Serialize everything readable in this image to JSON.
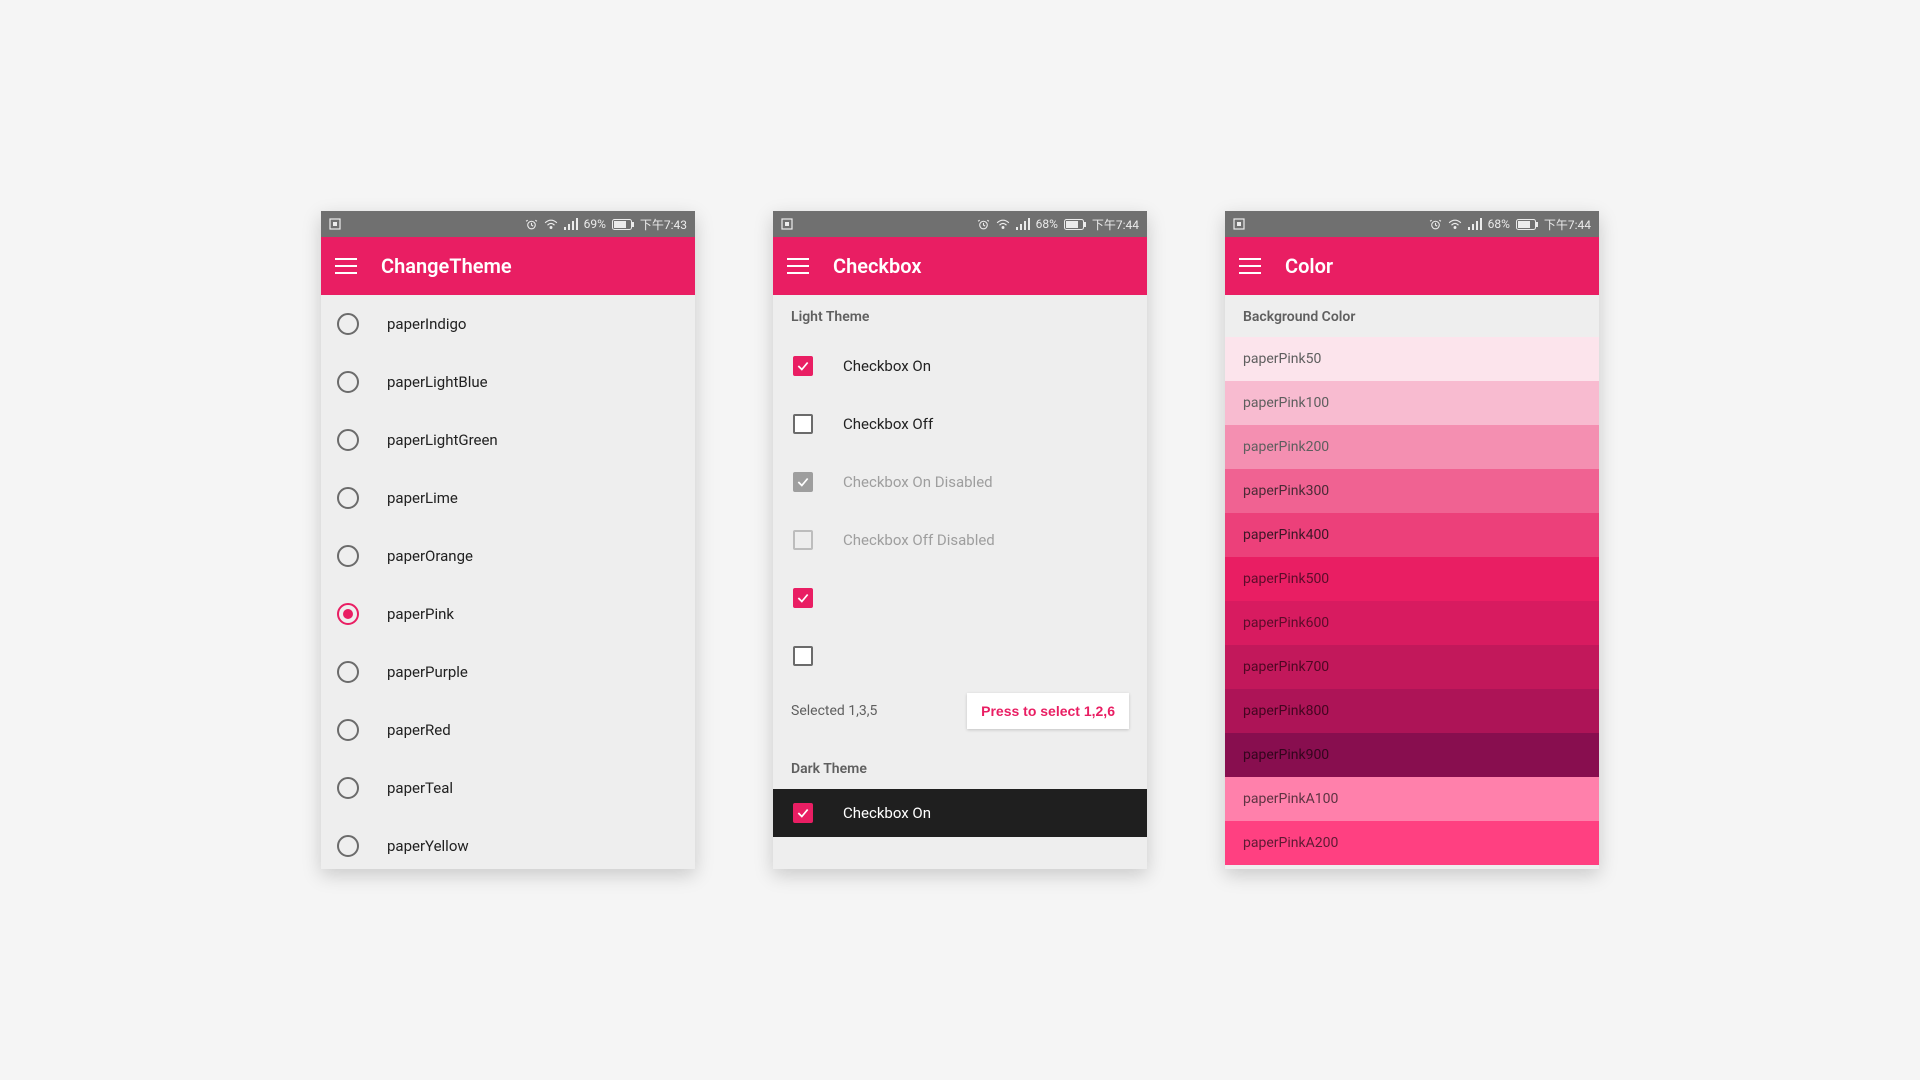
{
  "accent": "#e91e63",
  "screens": [
    {
      "statusbar": {
        "battery": "69%",
        "time": "下午7:43"
      },
      "title": "ChangeTheme",
      "themes": [
        {
          "label": "paperIndigo",
          "selected": false
        },
        {
          "label": "paperLightBlue",
          "selected": false
        },
        {
          "label": "paperLightGreen",
          "selected": false
        },
        {
          "label": "paperLime",
          "selected": false
        },
        {
          "label": "paperOrange",
          "selected": false
        },
        {
          "label": "paperPink",
          "selected": true
        },
        {
          "label": "paperPurple",
          "selected": false
        },
        {
          "label": "paperRed",
          "selected": false
        },
        {
          "label": "paperTeal",
          "selected": false
        },
        {
          "label": "paperYellow",
          "selected": false
        }
      ]
    },
    {
      "statusbar": {
        "battery": "68%",
        "time": "下午7:44"
      },
      "title": "Checkbox",
      "light_label": "Light Theme",
      "checkboxes": [
        {
          "label": "Checkbox On",
          "checked": true,
          "disabled": false
        },
        {
          "label": "Checkbox Off",
          "checked": false,
          "disabled": false
        },
        {
          "label": "Checkbox On Disabled",
          "checked": true,
          "disabled": true
        },
        {
          "label": "Checkbox Off Disabled",
          "checked": false,
          "disabled": true
        },
        {
          "label": "",
          "checked": true,
          "disabled": false
        },
        {
          "label": "",
          "checked": false,
          "disabled": false
        }
      ],
      "selected_text": "Selected 1,3,5",
      "button_label": "Press to select 1,2,6",
      "dark_label": "Dark Theme",
      "dark_checkbox": {
        "label": "Checkbox On",
        "checked": true
      }
    },
    {
      "statusbar": {
        "battery": "68%",
        "time": "下午7:44"
      },
      "title": "Color",
      "header": "Background Color",
      "swatches": [
        {
          "label": "paperPink50",
          "bg": "#fce4ec",
          "fg": "#5e5e5e"
        },
        {
          "label": "paperPink100",
          "bg": "#f8bbd0",
          "fg": "#5e5e5e"
        },
        {
          "label": "paperPink200",
          "bg": "#f48fb1",
          "fg": "#5e5e5e"
        },
        {
          "label": "paperPink300",
          "bg": "#f06292",
          "fg": "#4b2a36"
        },
        {
          "label": "paperPink400",
          "bg": "#ec407a",
          "fg": "#3d1626"
        },
        {
          "label": "paperPink500",
          "bg": "#e91e63",
          "fg": "#5c0c2a"
        },
        {
          "label": "paperPink600",
          "bg": "#d81b60",
          "fg": "#5c0c2a"
        },
        {
          "label": "paperPink700",
          "bg": "#c2185b",
          "fg": "#4e0723"
        },
        {
          "label": "paperPink800",
          "bg": "#ad1457",
          "fg": "#430520"
        },
        {
          "label": "paperPink900",
          "bg": "#880e4f",
          "fg": "#33051d"
        },
        {
          "label": "paperPinkA100",
          "bg": "#ff80ab",
          "fg": "#5e3342"
        },
        {
          "label": "paperPinkA200",
          "bg": "#ff4081",
          "fg": "#5e1a33"
        }
      ]
    }
  ]
}
